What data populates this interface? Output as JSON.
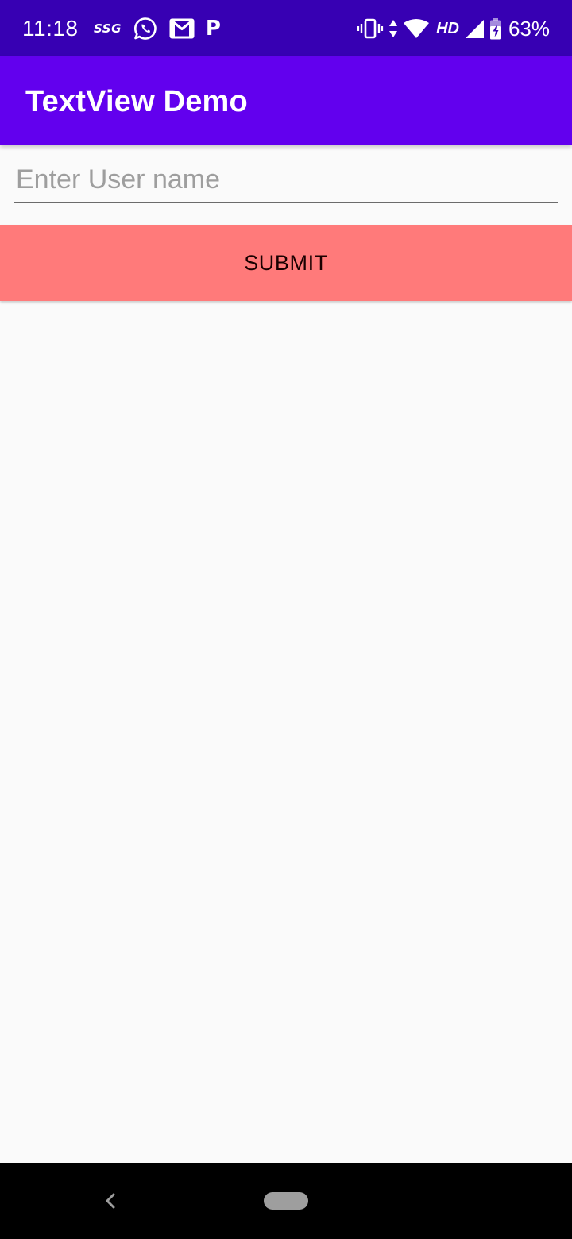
{
  "status_bar": {
    "time": "11:18",
    "left_icons": [
      "ssg-icon",
      "whatsapp-icon",
      "gmail-icon",
      "paytm-p-icon"
    ],
    "ssg_label": "SSG",
    "p_label": "P",
    "right_icons": [
      "vibrate-icon",
      "data-arrows-icon",
      "wifi-icon",
      "signal-icon",
      "battery-charging-icon"
    ],
    "hd_label": "HD",
    "battery_percent": "63%"
  },
  "app_bar": {
    "title": "TextView Demo",
    "color": "#6200ee"
  },
  "form": {
    "username_placeholder": "Enter User name",
    "username_value": "",
    "submit_label": "SUBMIT",
    "submit_color": "#ff7a7a"
  },
  "nav_bar": {
    "icons": [
      "back-icon",
      "home-pill-icon"
    ]
  },
  "colors": {
    "status_bar": "#3700b3",
    "app_bar": "#6200ee",
    "background": "#fafafa",
    "submit_button": "#ff7a7a",
    "nav_bar": "#000000"
  }
}
